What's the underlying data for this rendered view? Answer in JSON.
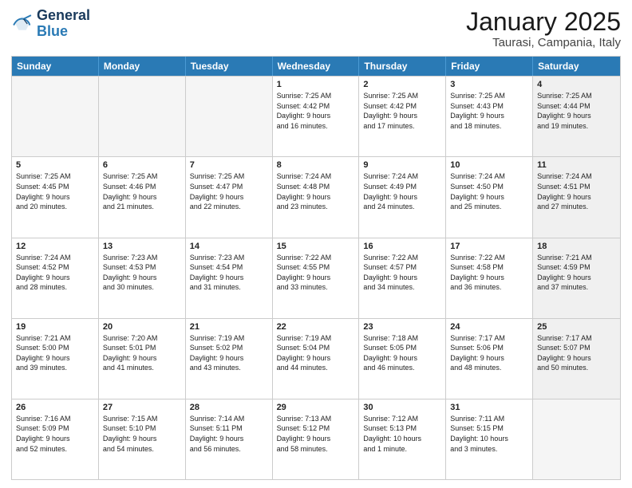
{
  "header": {
    "logo_general": "General",
    "logo_blue": "Blue",
    "title": "January 2025",
    "subtitle": "Taurasi, Campania, Italy"
  },
  "weekdays": [
    "Sunday",
    "Monday",
    "Tuesday",
    "Wednesday",
    "Thursday",
    "Friday",
    "Saturday"
  ],
  "weeks": [
    [
      {
        "day": "",
        "info": "",
        "empty": true
      },
      {
        "day": "",
        "info": "",
        "empty": true
      },
      {
        "day": "",
        "info": "",
        "empty": true
      },
      {
        "day": "1",
        "info": "Sunrise: 7:25 AM\nSunset: 4:42 PM\nDaylight: 9 hours\nand 16 minutes.",
        "empty": false
      },
      {
        "day": "2",
        "info": "Sunrise: 7:25 AM\nSunset: 4:42 PM\nDaylight: 9 hours\nand 17 minutes.",
        "empty": false
      },
      {
        "day": "3",
        "info": "Sunrise: 7:25 AM\nSunset: 4:43 PM\nDaylight: 9 hours\nand 18 minutes.",
        "empty": false
      },
      {
        "day": "4",
        "info": "Sunrise: 7:25 AM\nSunset: 4:44 PM\nDaylight: 9 hours\nand 19 minutes.",
        "empty": false,
        "shaded": true
      }
    ],
    [
      {
        "day": "5",
        "info": "Sunrise: 7:25 AM\nSunset: 4:45 PM\nDaylight: 9 hours\nand 20 minutes.",
        "empty": false
      },
      {
        "day": "6",
        "info": "Sunrise: 7:25 AM\nSunset: 4:46 PM\nDaylight: 9 hours\nand 21 minutes.",
        "empty": false
      },
      {
        "day": "7",
        "info": "Sunrise: 7:25 AM\nSunset: 4:47 PM\nDaylight: 9 hours\nand 22 minutes.",
        "empty": false
      },
      {
        "day": "8",
        "info": "Sunrise: 7:24 AM\nSunset: 4:48 PM\nDaylight: 9 hours\nand 23 minutes.",
        "empty": false
      },
      {
        "day": "9",
        "info": "Sunrise: 7:24 AM\nSunset: 4:49 PM\nDaylight: 9 hours\nand 24 minutes.",
        "empty": false
      },
      {
        "day": "10",
        "info": "Sunrise: 7:24 AM\nSunset: 4:50 PM\nDaylight: 9 hours\nand 25 minutes.",
        "empty": false
      },
      {
        "day": "11",
        "info": "Sunrise: 7:24 AM\nSunset: 4:51 PM\nDaylight: 9 hours\nand 27 minutes.",
        "empty": false,
        "shaded": true
      }
    ],
    [
      {
        "day": "12",
        "info": "Sunrise: 7:24 AM\nSunset: 4:52 PM\nDaylight: 9 hours\nand 28 minutes.",
        "empty": false
      },
      {
        "day": "13",
        "info": "Sunrise: 7:23 AM\nSunset: 4:53 PM\nDaylight: 9 hours\nand 30 minutes.",
        "empty": false
      },
      {
        "day": "14",
        "info": "Sunrise: 7:23 AM\nSunset: 4:54 PM\nDaylight: 9 hours\nand 31 minutes.",
        "empty": false
      },
      {
        "day": "15",
        "info": "Sunrise: 7:22 AM\nSunset: 4:55 PM\nDaylight: 9 hours\nand 33 minutes.",
        "empty": false
      },
      {
        "day": "16",
        "info": "Sunrise: 7:22 AM\nSunset: 4:57 PM\nDaylight: 9 hours\nand 34 minutes.",
        "empty": false
      },
      {
        "day": "17",
        "info": "Sunrise: 7:22 AM\nSunset: 4:58 PM\nDaylight: 9 hours\nand 36 minutes.",
        "empty": false
      },
      {
        "day": "18",
        "info": "Sunrise: 7:21 AM\nSunset: 4:59 PM\nDaylight: 9 hours\nand 37 minutes.",
        "empty": false,
        "shaded": true
      }
    ],
    [
      {
        "day": "19",
        "info": "Sunrise: 7:21 AM\nSunset: 5:00 PM\nDaylight: 9 hours\nand 39 minutes.",
        "empty": false
      },
      {
        "day": "20",
        "info": "Sunrise: 7:20 AM\nSunset: 5:01 PM\nDaylight: 9 hours\nand 41 minutes.",
        "empty": false
      },
      {
        "day": "21",
        "info": "Sunrise: 7:19 AM\nSunset: 5:02 PM\nDaylight: 9 hours\nand 43 minutes.",
        "empty": false
      },
      {
        "day": "22",
        "info": "Sunrise: 7:19 AM\nSunset: 5:04 PM\nDaylight: 9 hours\nand 44 minutes.",
        "empty": false
      },
      {
        "day": "23",
        "info": "Sunrise: 7:18 AM\nSunset: 5:05 PM\nDaylight: 9 hours\nand 46 minutes.",
        "empty": false
      },
      {
        "day": "24",
        "info": "Sunrise: 7:17 AM\nSunset: 5:06 PM\nDaylight: 9 hours\nand 48 minutes.",
        "empty": false
      },
      {
        "day": "25",
        "info": "Sunrise: 7:17 AM\nSunset: 5:07 PM\nDaylight: 9 hours\nand 50 minutes.",
        "empty": false,
        "shaded": true
      }
    ],
    [
      {
        "day": "26",
        "info": "Sunrise: 7:16 AM\nSunset: 5:09 PM\nDaylight: 9 hours\nand 52 minutes.",
        "empty": false
      },
      {
        "day": "27",
        "info": "Sunrise: 7:15 AM\nSunset: 5:10 PM\nDaylight: 9 hours\nand 54 minutes.",
        "empty": false
      },
      {
        "day": "28",
        "info": "Sunrise: 7:14 AM\nSunset: 5:11 PM\nDaylight: 9 hours\nand 56 minutes.",
        "empty": false
      },
      {
        "day": "29",
        "info": "Sunrise: 7:13 AM\nSunset: 5:12 PM\nDaylight: 9 hours\nand 58 minutes.",
        "empty": false
      },
      {
        "day": "30",
        "info": "Sunrise: 7:12 AM\nSunset: 5:13 PM\nDaylight: 10 hours\nand 1 minute.",
        "empty": false
      },
      {
        "day": "31",
        "info": "Sunrise: 7:11 AM\nSunset: 5:15 PM\nDaylight: 10 hours\nand 3 minutes.",
        "empty": false
      },
      {
        "day": "",
        "info": "",
        "empty": true,
        "shaded": true
      }
    ]
  ]
}
